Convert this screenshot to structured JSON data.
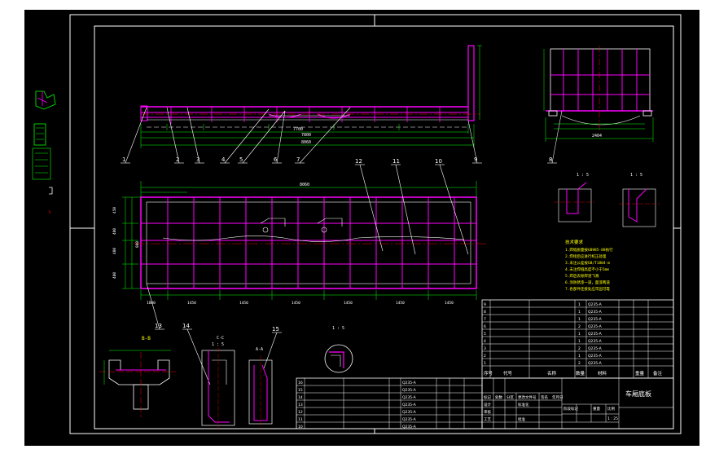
{
  "balloons": [
    {
      "id": "b1",
      "label": "1"
    },
    {
      "id": "b2",
      "label": "2"
    },
    {
      "id": "b3",
      "label": "3"
    },
    {
      "id": "b4",
      "label": "4"
    },
    {
      "id": "b5",
      "label": "5"
    },
    {
      "id": "b6",
      "label": "6"
    },
    {
      "id": "b7",
      "label": "7"
    },
    {
      "id": "b8",
      "label": "8"
    },
    {
      "id": "b9",
      "label": "9"
    },
    {
      "id": "b10",
      "label": "10"
    },
    {
      "id": "b11",
      "label": "11"
    },
    {
      "id": "b12",
      "label": "12"
    },
    {
      "id": "b13",
      "label": "13"
    },
    {
      "id": "b14",
      "label": "14"
    },
    {
      "id": "b15",
      "label": "15"
    }
  ],
  "section_labels": {
    "bb": "B-B",
    "cc": "C-C",
    "aa": "A-A",
    "scale_1_5a": "1 : 5",
    "scale_1_5b": "1 : 5",
    "scale_1_5c": "1 : 5"
  },
  "dims": {
    "top_d1": "7700",
    "top_d2": "7800",
    "top_d3": "8060",
    "plan_overall": "8060",
    "plan_seg": [
      "1800",
      "1450",
      "1450",
      "1450",
      "1450",
      "1450",
      "1450"
    ],
    "plan_side": [
      "450",
      "400",
      "400",
      "400",
      "800"
    ],
    "end_w": "2404"
  },
  "tech_notes": {
    "title": "技术要求",
    "lines": [
      "1.焊缝质量按GB985-88执行",
      "2.焊接后应进行校正处理",
      "3.未注公差按GB/T1804-m",
      "4.未注焊缝高度不小于5mm",
      "5.焊后去除焊渣飞溅",
      "6.涂防锈漆一道，面漆两道",
      "7.各部件连接处应牢固可靠"
    ]
  },
  "bom_right": {
    "headers": [
      "序号",
      "代号",
      "名称",
      "数量",
      "材料",
      "重量",
      "备注"
    ],
    "rows": [
      [
        "9",
        "",
        "",
        "1",
        "Q235-A",
        "",
        ""
      ],
      [
        "8",
        "",
        "",
        "1",
        "Q235-A",
        "",
        ""
      ],
      [
        "7",
        "",
        "",
        "1",
        "Q235-A",
        "",
        ""
      ],
      [
        "6",
        "",
        "",
        "2",
        "Q235-A",
        "",
        ""
      ],
      [
        "5",
        "",
        "",
        "1",
        "Q235-A",
        "",
        ""
      ],
      [
        "4",
        "",
        "",
        "1",
        "Q235-A",
        "",
        ""
      ],
      [
        "3",
        "",
        "",
        "2",
        "Q235-A",
        "",
        ""
      ],
      [
        "2",
        "",
        "",
        "1",
        "Q235-A",
        "",
        ""
      ],
      [
        "1",
        "",
        "",
        "2",
        "Q235-A",
        "",
        ""
      ]
    ]
  },
  "bom_left": {
    "rows": [
      [
        "16",
        "",
        "",
        "",
        "Q235-A",
        "",
        ""
      ],
      [
        "15",
        "",
        "",
        "",
        "Q235-A",
        "",
        ""
      ],
      [
        "14",
        "",
        "",
        "",
        "Q235-A",
        "",
        ""
      ],
      [
        "13",
        "",
        "",
        "",
        "Q235-A",
        "",
        ""
      ],
      [
        "12",
        "",
        "",
        "",
        "Q235-A",
        "",
        ""
      ],
      [
        "11",
        "",
        "",
        "",
        "Q235-A",
        "",
        ""
      ],
      [
        "10",
        "",
        "",
        "",
        "Q235-A",
        "",
        ""
      ]
    ]
  },
  "title_block": {
    "drawing_name": "车厢底板",
    "cells": [
      "标记",
      "处数",
      "分区",
      "更改文件号",
      "签名",
      "年月日",
      "设计",
      "标准化",
      "审核",
      "工艺",
      "批准",
      "阶段标记",
      "重量",
      "比例"
    ],
    "scale": "1 : 25"
  },
  "colors": {
    "bg": "#000000",
    "frame": "#ffffff",
    "part": "#ff00ff",
    "dim": "#00ff00",
    "text": "#ffffff",
    "center": "#ff0000",
    "hidden": "#ffff00"
  }
}
